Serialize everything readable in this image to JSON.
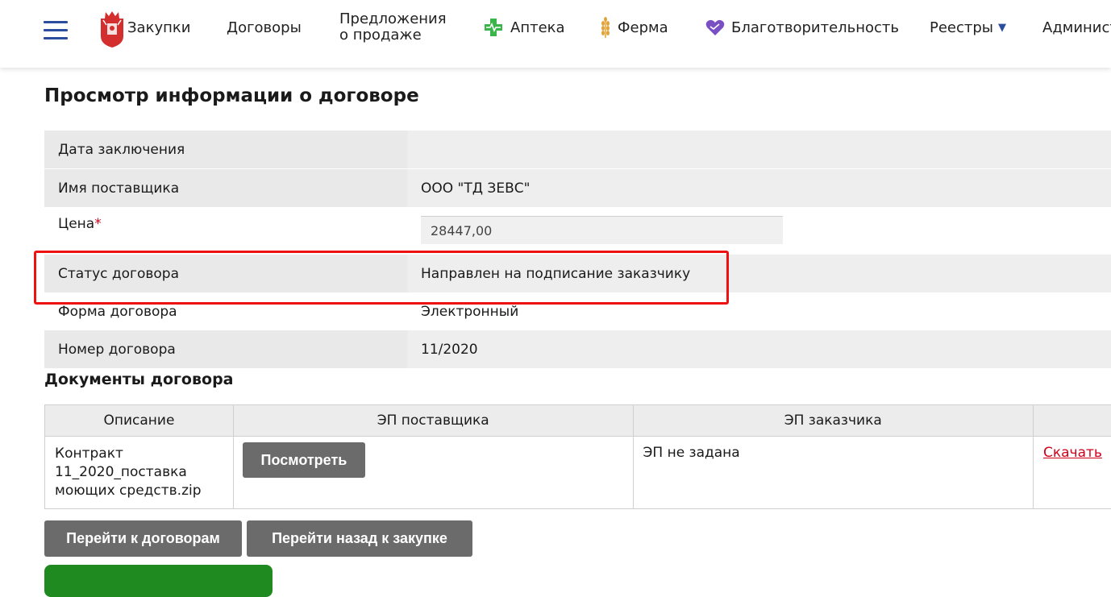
{
  "header": {
    "menu_icon": "hamburger-menu-icon",
    "logo_icon": "moscow-region-coat-of-arms-icon",
    "nav": {
      "zakupki": "Закупки",
      "dogovory": "Договоры",
      "predlozheniya_line1": "Предложения",
      "predlozheniya_line2": "о продаже",
      "apteka": "Аптека",
      "ferma": "Ферма",
      "blago": "Благотворительность",
      "reestry": "Реестры",
      "admin": "Админист"
    },
    "icons": {
      "apteka": "pharmacy-cross-icon",
      "ferma": "wheat-icon",
      "blago": "charity-heart-icon",
      "caret": "dropdown-triangle-icon"
    },
    "colors": {
      "accent": "#2b4d9e",
      "pharmacy": "#3bb54a",
      "wheat": "#e0a43a",
      "charity": "#7b4fc4"
    }
  },
  "page": {
    "title": "Просмотр информации о договоре"
  },
  "info": {
    "date_label": "Дата заключения",
    "date_value": "",
    "supplier_label": "Имя поставщика",
    "supplier_value": "ООО \"ТД ЗЕВС\"",
    "price_label": "Цена",
    "price_required": "*",
    "price_value": "28447,00",
    "status_label": "Статус договора",
    "status_value": "Направлен на подписание заказчику",
    "form_label": "Форма договора",
    "form_value": "Электронный",
    "number_label": "Номер договора",
    "number_value": "11/2020"
  },
  "docs": {
    "title": "Документы договора",
    "headers": [
      "Описание",
      "ЭП поставщика",
      "ЭП заказчика",
      ""
    ],
    "row": {
      "desc_line1": "Контракт",
      "desc_line2": "11_2020_поставка",
      "desc_line3": "моющих средств.zip",
      "view_button": "Посмотреть",
      "customer_sig": "ЭП не задана",
      "download": "Скачать"
    }
  },
  "actions": {
    "to_contracts": "Перейти к договорам",
    "back_to_purchase": "Перейти назад к закупке"
  },
  "colors": {
    "highlight": "#ee1111",
    "button": "#6b6b6b",
    "green_button": "#1f8a1f",
    "link": "#d0021b"
  }
}
